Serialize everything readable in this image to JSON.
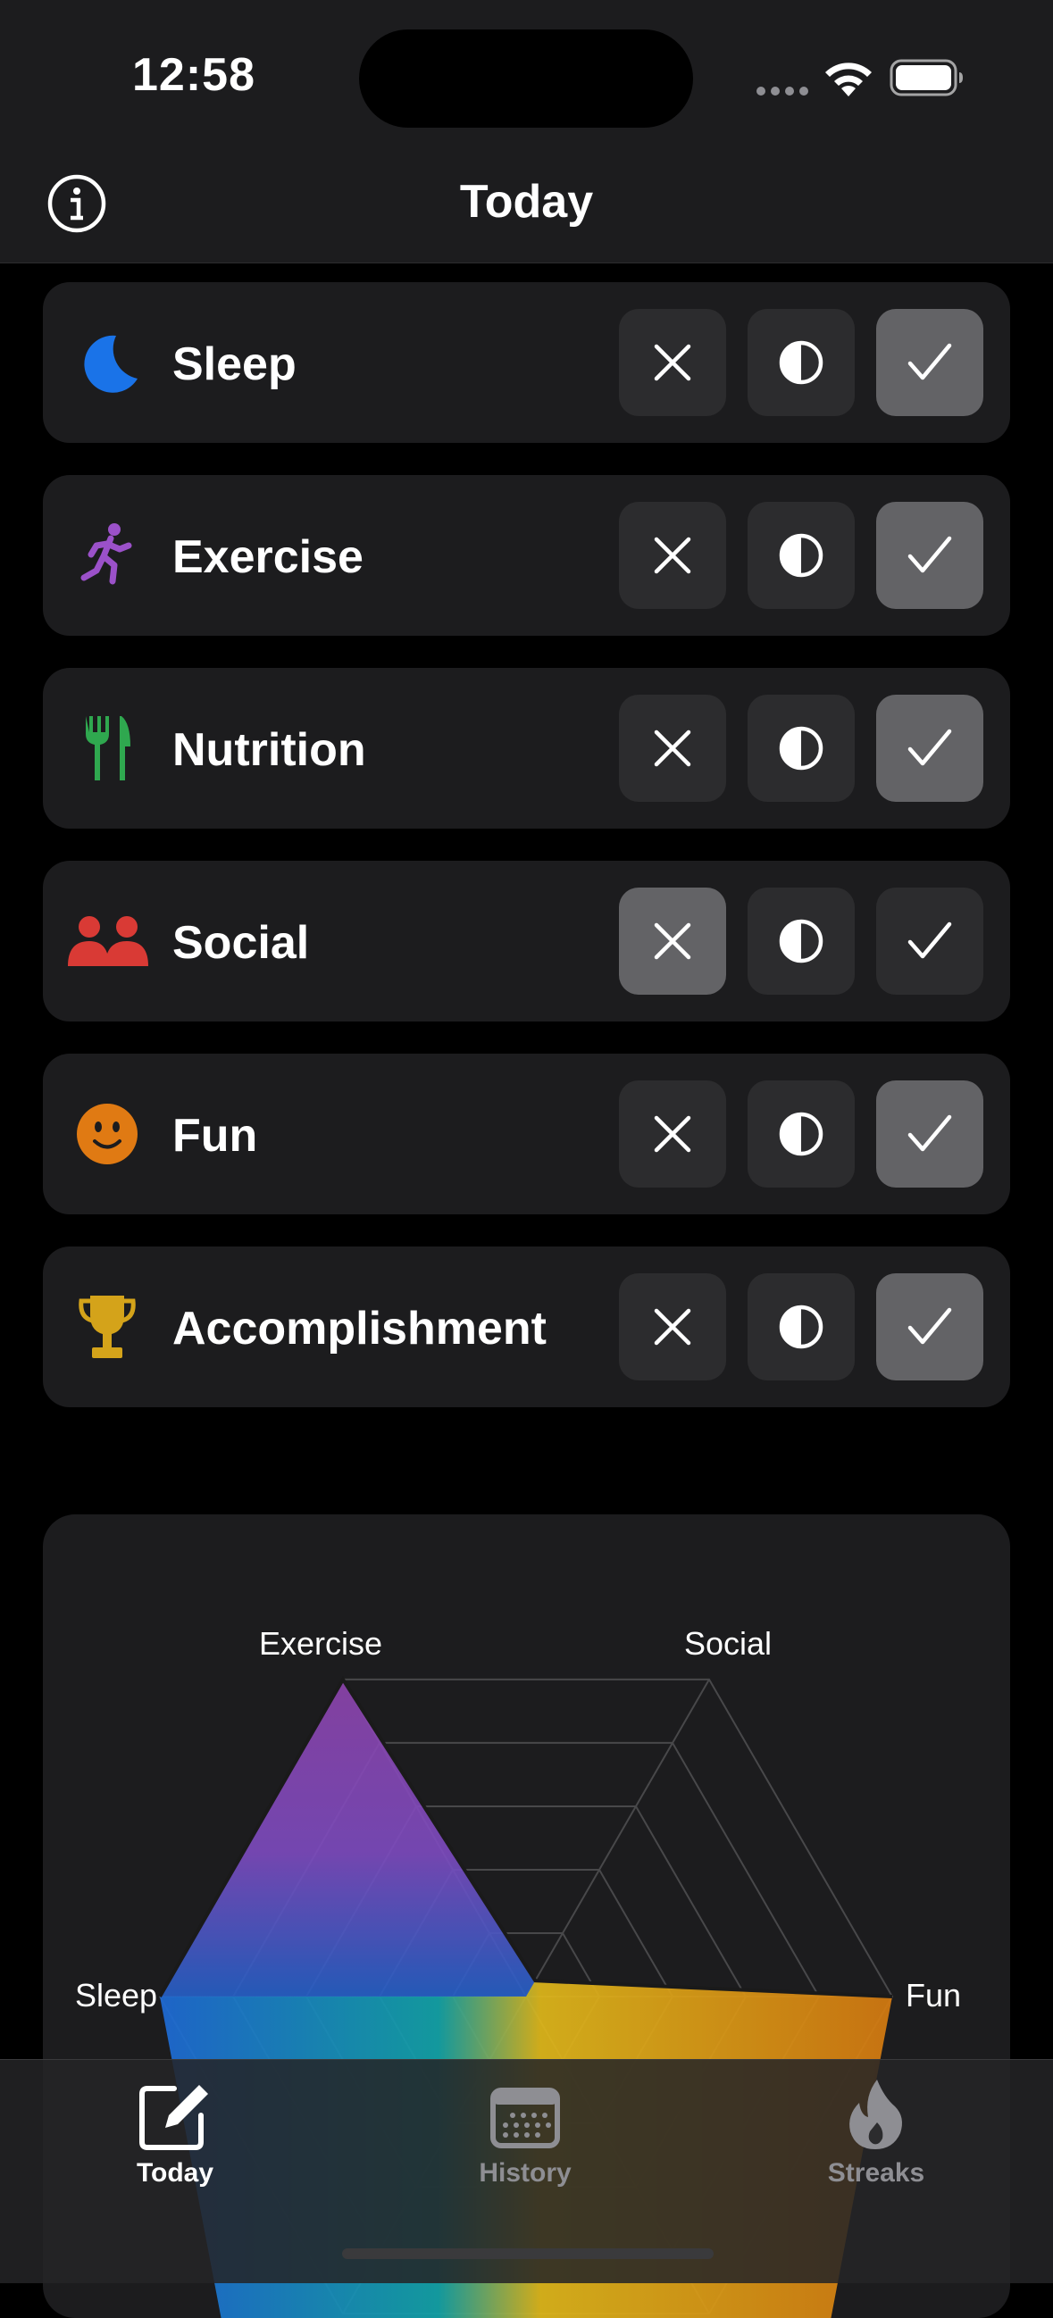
{
  "status_bar": {
    "time": "12:58"
  },
  "nav": {
    "title": "Today",
    "info_icon": "info-circle-icon"
  },
  "choices": {
    "no": "x-mark-icon",
    "partial": "half-circle-icon",
    "yes": "checkmark-icon"
  },
  "habits": [
    {
      "label": "Sleep",
      "icon": "moon-icon",
      "color": "#1a73e8",
      "selected": "yes"
    },
    {
      "label": "Exercise",
      "icon": "running-figure-icon",
      "color": "#9b51c9",
      "selected": "yes"
    },
    {
      "label": "Nutrition",
      "icon": "fork-knife-icon",
      "color": "#2fa84f",
      "selected": "yes"
    },
    {
      "label": "Social",
      "icon": "people-icon",
      "color": "#d93a35",
      "selected": "no"
    },
    {
      "label": "Fun",
      "icon": "smiley-icon",
      "color": "#e07a13",
      "selected": "yes"
    },
    {
      "label": "Accomplishment",
      "icon": "trophy-icon",
      "color": "#d4a31a",
      "selected": "yes"
    }
  ],
  "chart_data": {
    "type": "radar",
    "axes": [
      "Exercise",
      "Social",
      "Fun",
      "Sleep"
    ],
    "levels": 5,
    "values": {
      "Exercise": 1.0,
      "Social": 0.0,
      "Fun": 1.0,
      "Sleep": 1.0
    }
  },
  "tabs": [
    {
      "label": "Today",
      "icon": "square-pencil-icon",
      "active": true
    },
    {
      "label": "History",
      "icon": "calendar-icon",
      "active": false
    },
    {
      "label": "Streaks",
      "icon": "flame-icon",
      "active": false
    }
  ]
}
